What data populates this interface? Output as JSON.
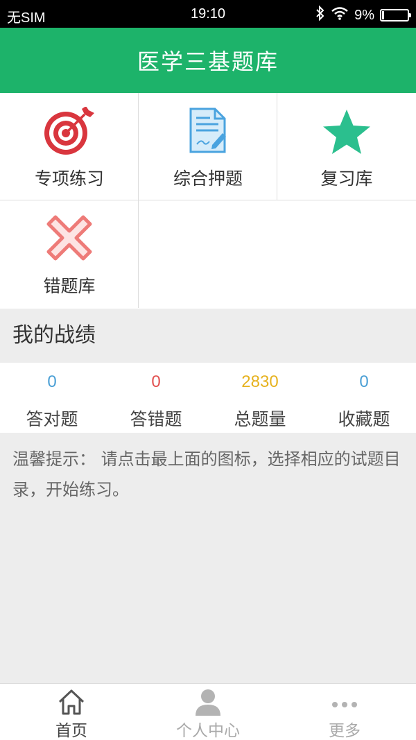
{
  "status_bar": {
    "carrier": "无SIM",
    "time": "19:10",
    "battery": "9%",
    "battery_level": 0.09,
    "icons": [
      "bluetooth-icon",
      "wifi-icon",
      "battery-icon"
    ]
  },
  "header": {
    "title": "医学三基题库"
  },
  "menu": {
    "items": [
      {
        "label": "专项练习",
        "icon": "target-icon"
      },
      {
        "label": "综合押题",
        "icon": "document-pen-icon"
      },
      {
        "label": "复习库",
        "icon": "star-icon"
      },
      {
        "label": "错题库",
        "icon": "cross-icon"
      }
    ]
  },
  "record": {
    "title": "我的战绩",
    "stats": [
      {
        "value": "0",
        "label": "答对题",
        "color": "#4a9fd5"
      },
      {
        "value": "0",
        "label": "答错题",
        "color": "#e2504f"
      },
      {
        "value": "2830",
        "label": "总题量",
        "color": "#e6b21f"
      },
      {
        "value": "0",
        "label": "收藏题",
        "color": "#4a9fd5"
      }
    ]
  },
  "tip": {
    "text": "温馨提示： 请点击最上面的图标，选择相应的试题目录，开始练习。"
  },
  "bottom_nav": {
    "items": [
      {
        "label": "首页",
        "icon": "home-icon",
        "active": true
      },
      {
        "label": "个人中心",
        "icon": "person-icon",
        "active": false
      },
      {
        "label": "更多",
        "icon": "more-icon",
        "active": false
      }
    ]
  },
  "colors": {
    "primary": "#1db36a",
    "target_red": "#d9363e",
    "star_green": "#2bbf8e",
    "doc_blue": "#4aa3df",
    "cross_red": "#ee7b78"
  }
}
